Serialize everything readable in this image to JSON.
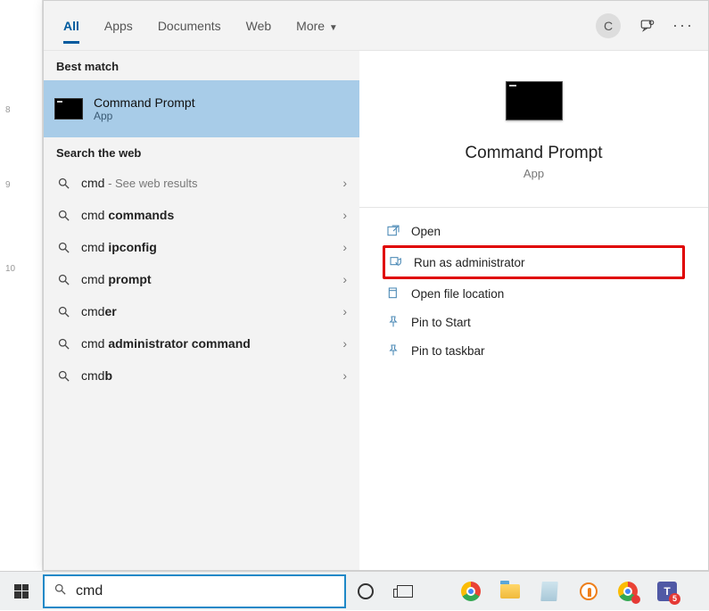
{
  "ruler": {
    "t8": "8",
    "t9": "9",
    "t10": "10"
  },
  "tabs": {
    "all": "All",
    "apps": "Apps",
    "documents": "Documents",
    "web": "Web",
    "more": "More"
  },
  "avatar_letter": "C",
  "sections": {
    "best_match": "Best match",
    "search_web": "Search the web"
  },
  "best_match": {
    "title": "Command Prompt",
    "sub": "App"
  },
  "web": [
    {
      "pre": "cmd",
      "bold": "",
      "hint": " - See web results"
    },
    {
      "pre": "cmd ",
      "bold": "commands",
      "hint": ""
    },
    {
      "pre": "cmd ",
      "bold": "ipconfig",
      "hint": ""
    },
    {
      "pre": "cmd ",
      "bold": "prompt",
      "hint": ""
    },
    {
      "pre": "cmd",
      "bold": "er",
      "hint": ""
    },
    {
      "pre": "cmd ",
      "bold": "administrator command",
      "hint": ""
    },
    {
      "pre": "cmd",
      "bold": "b",
      "hint": ""
    }
  ],
  "preview": {
    "title": "Command Prompt",
    "sub": "App"
  },
  "actions": {
    "open": "Open",
    "run_admin": "Run as administrator",
    "open_loc": "Open file location",
    "pin_start": "Pin to Start",
    "pin_taskbar": "Pin to taskbar"
  },
  "search_value": "cmd",
  "teams_badge": "5"
}
